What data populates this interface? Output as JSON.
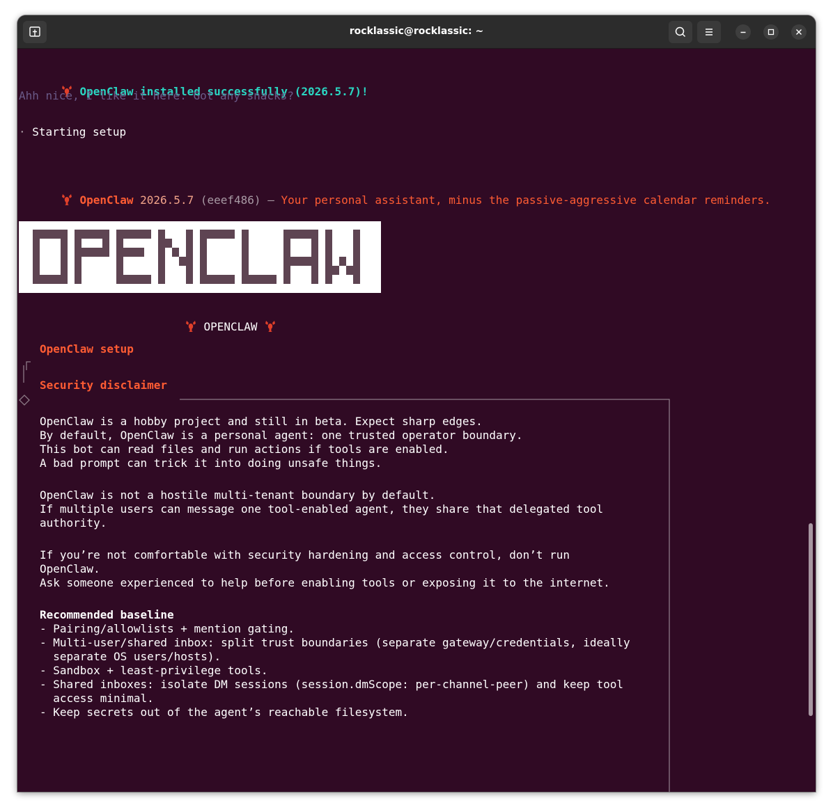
{
  "window": {
    "title": "rocklassic@rocklassic: ~"
  },
  "terminal": {
    "install": {
      "icon": "lobster-icon",
      "message": "OpenClaw installed successfully (2026.5.7)!"
    },
    "quip": "Ahh nice, I like it here. Got any snacks?",
    "starting": {
      "bullet": "·",
      "text": "Starting setup"
    },
    "version_line": {
      "name": "OpenClaw",
      "version": "2026.5.7",
      "commit": "(eeef486)",
      "dash": "—",
      "tagline": "Your personal assistant, minus the passive-aggressive calendar reminders."
    },
    "banner_text": "OPENCLAW",
    "caption": "OPENCLAW",
    "setup_title": "OpenClaw setup",
    "disclaimer_title": "Security disclaimer",
    "disclaimer_lines": [
      "OpenClaw is a hobby project and still in beta. Expect sharp edges.",
      "By default, OpenClaw is a personal agent: one trusted operator boundary.",
      "This bot can read files and run actions if tools are enabled.",
      "A bad prompt can trick it into doing unsafe things.",
      "",
      "OpenClaw is not a hostile multi-tenant boundary by default.",
      "If multiple users can message one tool-enabled agent, they share that delegated tool",
      "authority.",
      "",
      "If you’re not comfortable with security hardening and access control, don’t run",
      "OpenClaw.",
      "Ask someone experienced to help before enabling tools or exposing it to the internet.",
      ""
    ],
    "baseline_title": "Recommended baseline",
    "baseline_lines": [
      "- Pairing/allowlists + mention gating.",
      "- Multi-user/shared inbox: split trust boundaries (separate gateway/credentials, ideally",
      "  separate OS users/hosts).",
      "- Sandbox + least-privilege tools.",
      "- Shared inboxes: isolate DM sessions (session.dmScope: per-channel-peer) and keep tool",
      "  access minimal.",
      "- Keep secrets out of the agent’s reachable filesystem."
    ]
  },
  "colors": {
    "terminal_bg": "#300a24",
    "titlebar_bg": "#2c2c2c",
    "success": "#2ad6c2",
    "accent": "#ff5c33",
    "muted": "#6a5a88",
    "banner_pixel": "#5e4452"
  }
}
